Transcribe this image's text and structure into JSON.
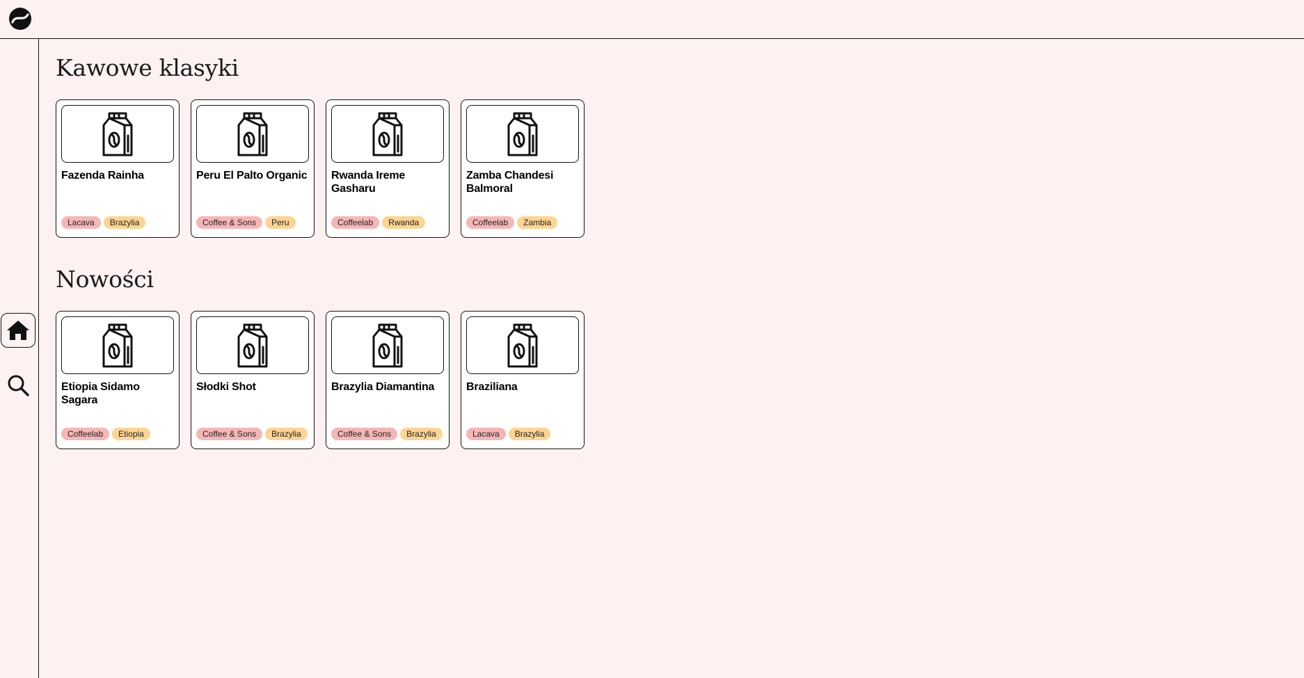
{
  "colors": {
    "background": "#fdf2f1",
    "card": "#ffffff",
    "border": "#111111",
    "roaster_tag": "#f6b6b6",
    "origin_tag": "#fdd592"
  },
  "header": {
    "logo_icon": "coffee-bean-logo-icon"
  },
  "sidebar": {
    "items": [
      {
        "icon": "home-icon",
        "active": true
      },
      {
        "icon": "search-icon",
        "active": false
      }
    ]
  },
  "sections": [
    {
      "title": "Kawowe klasyki",
      "cards": [
        {
          "name": "Fazenda Rainha",
          "icon": "coffee-bag-icon",
          "roaster": "Lacava",
          "origin": "Brazylia"
        },
        {
          "name": "Peru El Palto Organic",
          "icon": "coffee-bag-icon",
          "roaster": "Coffee & Sons",
          "origin": "Peru"
        },
        {
          "name": "Rwanda Ireme Gasharu",
          "icon": "coffee-bag-icon",
          "roaster": "Coffeelab",
          "origin": "Rwanda"
        },
        {
          "name": "Zamba Chandesi Balmoral",
          "icon": "coffee-bag-icon",
          "roaster": "Coffeelab",
          "origin": "Zambia"
        }
      ]
    },
    {
      "title": "Nowości",
      "cards": [
        {
          "name": "Etiopia Sidamo Sagara",
          "icon": "coffee-bag-icon",
          "roaster": "Coffeelab",
          "origin": "Etiopia"
        },
        {
          "name": "Słodki Shot",
          "icon": "coffee-bag-icon",
          "roaster": "Coffee & Sons",
          "origin": "Brazylia"
        },
        {
          "name": "Brazylia Diamantina",
          "icon": "coffee-bag-icon",
          "roaster": "Coffee & Sons",
          "origin": "Brazylia"
        },
        {
          "name": "Braziliana",
          "icon": "coffee-bag-icon",
          "roaster": "Lacava",
          "origin": "Brazylia"
        }
      ]
    }
  ]
}
